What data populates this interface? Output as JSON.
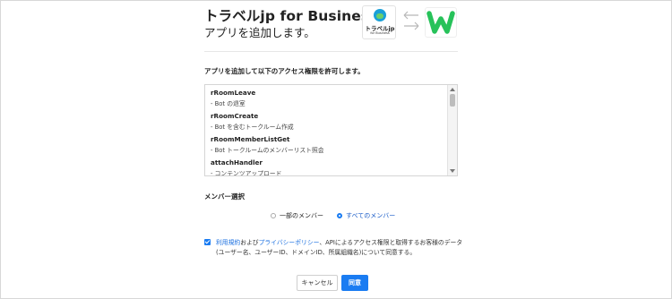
{
  "header": {
    "title": "トラベルjp for Business",
    "subtitle": "アプリを追加します。",
    "app_logo_text": "トラベルjp",
    "app_logo_sub": "for Business"
  },
  "permissions": {
    "heading": "アプリを追加して以下のアクセス権限を許可します。",
    "items": [
      {
        "name": "rRoomLeave",
        "desc": "- Bot の退室"
      },
      {
        "name": "rRoomCreate",
        "desc": "- Bot を含むトークルーム作成"
      },
      {
        "name": "rRoomMemberListGet",
        "desc": "- Bot トークルームのメンバーリスト照会"
      },
      {
        "name": "attachHandler",
        "desc": "- コンテンツアップロード"
      }
    ]
  },
  "members": {
    "heading": "メンバー選択",
    "option_part": "一部のメンバー",
    "option_all": "すべてのメンバー",
    "selected": "すべてのメンバー"
  },
  "agreement": {
    "checked": true,
    "link_terms": "利用規約",
    "text_and": "および",
    "link_privacy": "プライバシーポリシー",
    "text_rest": "、APIによるアクセス権限と取得するお客様のデータ(ユーザー名、ユーザーID、ドメインID、所属組織名)について同意する。"
  },
  "buttons": {
    "cancel": "キャンセル",
    "agree": "同意"
  },
  "colors": {
    "accent": "#1a7cf2",
    "w_logo_green": "#27c25a"
  }
}
